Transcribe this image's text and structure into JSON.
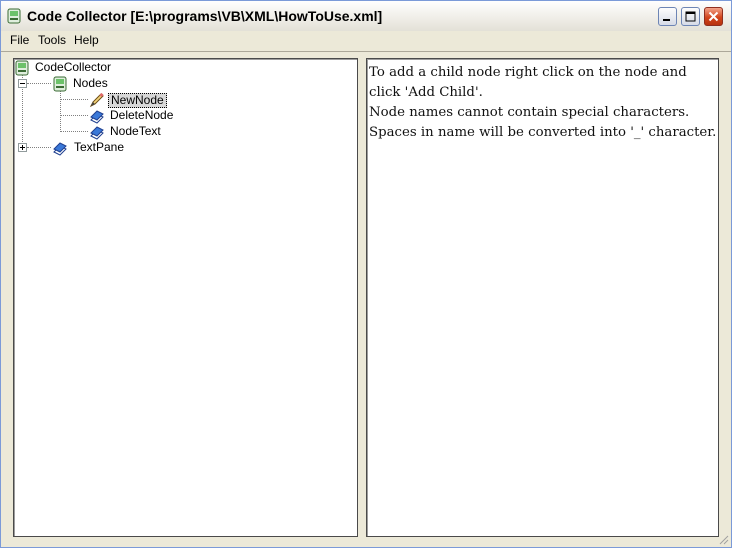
{
  "window": {
    "title": "Code Collector [E:\\programs\\VB\\XML\\HowToUse.xml]"
  },
  "menu": {
    "items": [
      "File",
      "Tools",
      "Help"
    ]
  },
  "tree": {
    "root": "CodeCollector",
    "nodes": [
      {
        "label": "Nodes",
        "expanded": true
      },
      {
        "label": "NewNode",
        "selected": true
      },
      {
        "label": "DeleteNode"
      },
      {
        "label": "NodeText"
      },
      {
        "label": "TextPane",
        "expanded": false
      }
    ]
  },
  "text_pane": {
    "lines": [
      "To add a child node right click on the node and",
      "click 'Add Child'.",
      "Node names cannot contain special characters.",
      "Spaces in name will be converted into '_' character."
    ]
  }
}
